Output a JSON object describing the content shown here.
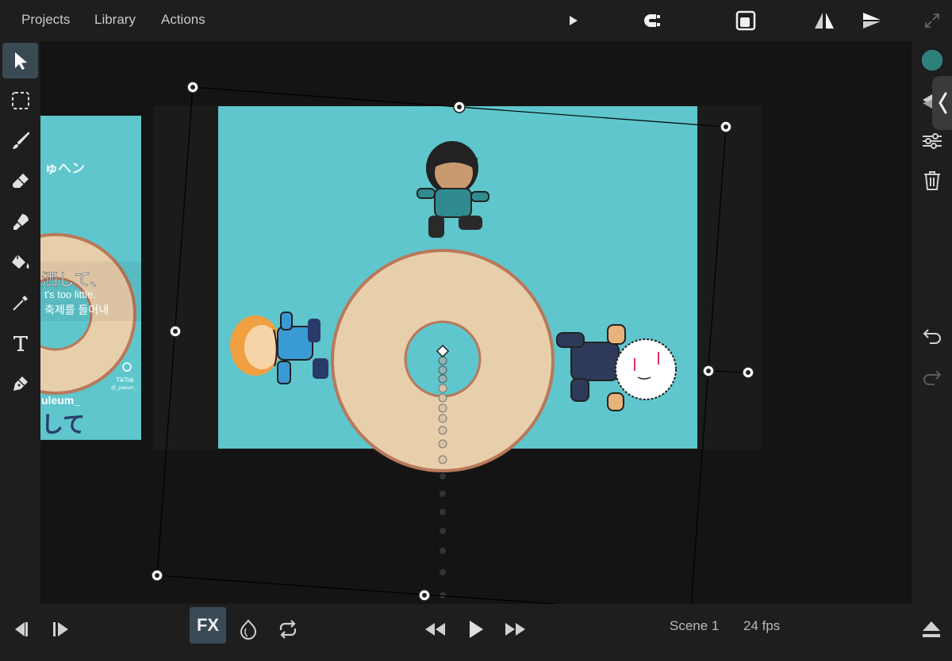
{
  "menu": {
    "projects": "Projects",
    "library": "Library",
    "actions": "Actions"
  },
  "toolbar_top": {
    "icons": [
      "play-small-icon",
      "magnet-icon",
      "layer-mode-icon",
      "flip-horizontal-icon",
      "flip-vertical-icon",
      "fullscreen-icon"
    ]
  },
  "tools_left": [
    "select-arrow-icon",
    "marquee-select-icon",
    "brush-icon",
    "eraser-icon",
    "smudge-icon",
    "fill-bucket-icon",
    "eyedropper-icon",
    "text-icon",
    "pen-icon"
  ],
  "tools_right": [
    "color-swatch",
    "layers-icon",
    "adjustments-icon",
    "trash-icon",
    "undo-icon",
    "redo-icon"
  ],
  "colors": {
    "accent": "#3a4a55",
    "swatch": "#2f7f7a",
    "stage_bg": "#5ec6cc",
    "donut": "#e8cfac",
    "donut_outline": "#b9785a"
  },
  "reference_image": {
    "lines": [
      "ゅへン",
      "洒して、",
      "t's too little.",
      "축제를 들어내",
      "TikTok",
      "@_paleum_",
      "uleum_",
      "して"
    ]
  },
  "bottom": {
    "fx_label": "FX",
    "scene_label": "Scene 1",
    "fps_label": "24 fps",
    "icons": [
      "step-back-icon",
      "step-forward-icon",
      "onion-skin-icon",
      "loop-icon",
      "rewind-icon",
      "play-icon",
      "fast-forward-icon",
      "eject-icon"
    ]
  }
}
